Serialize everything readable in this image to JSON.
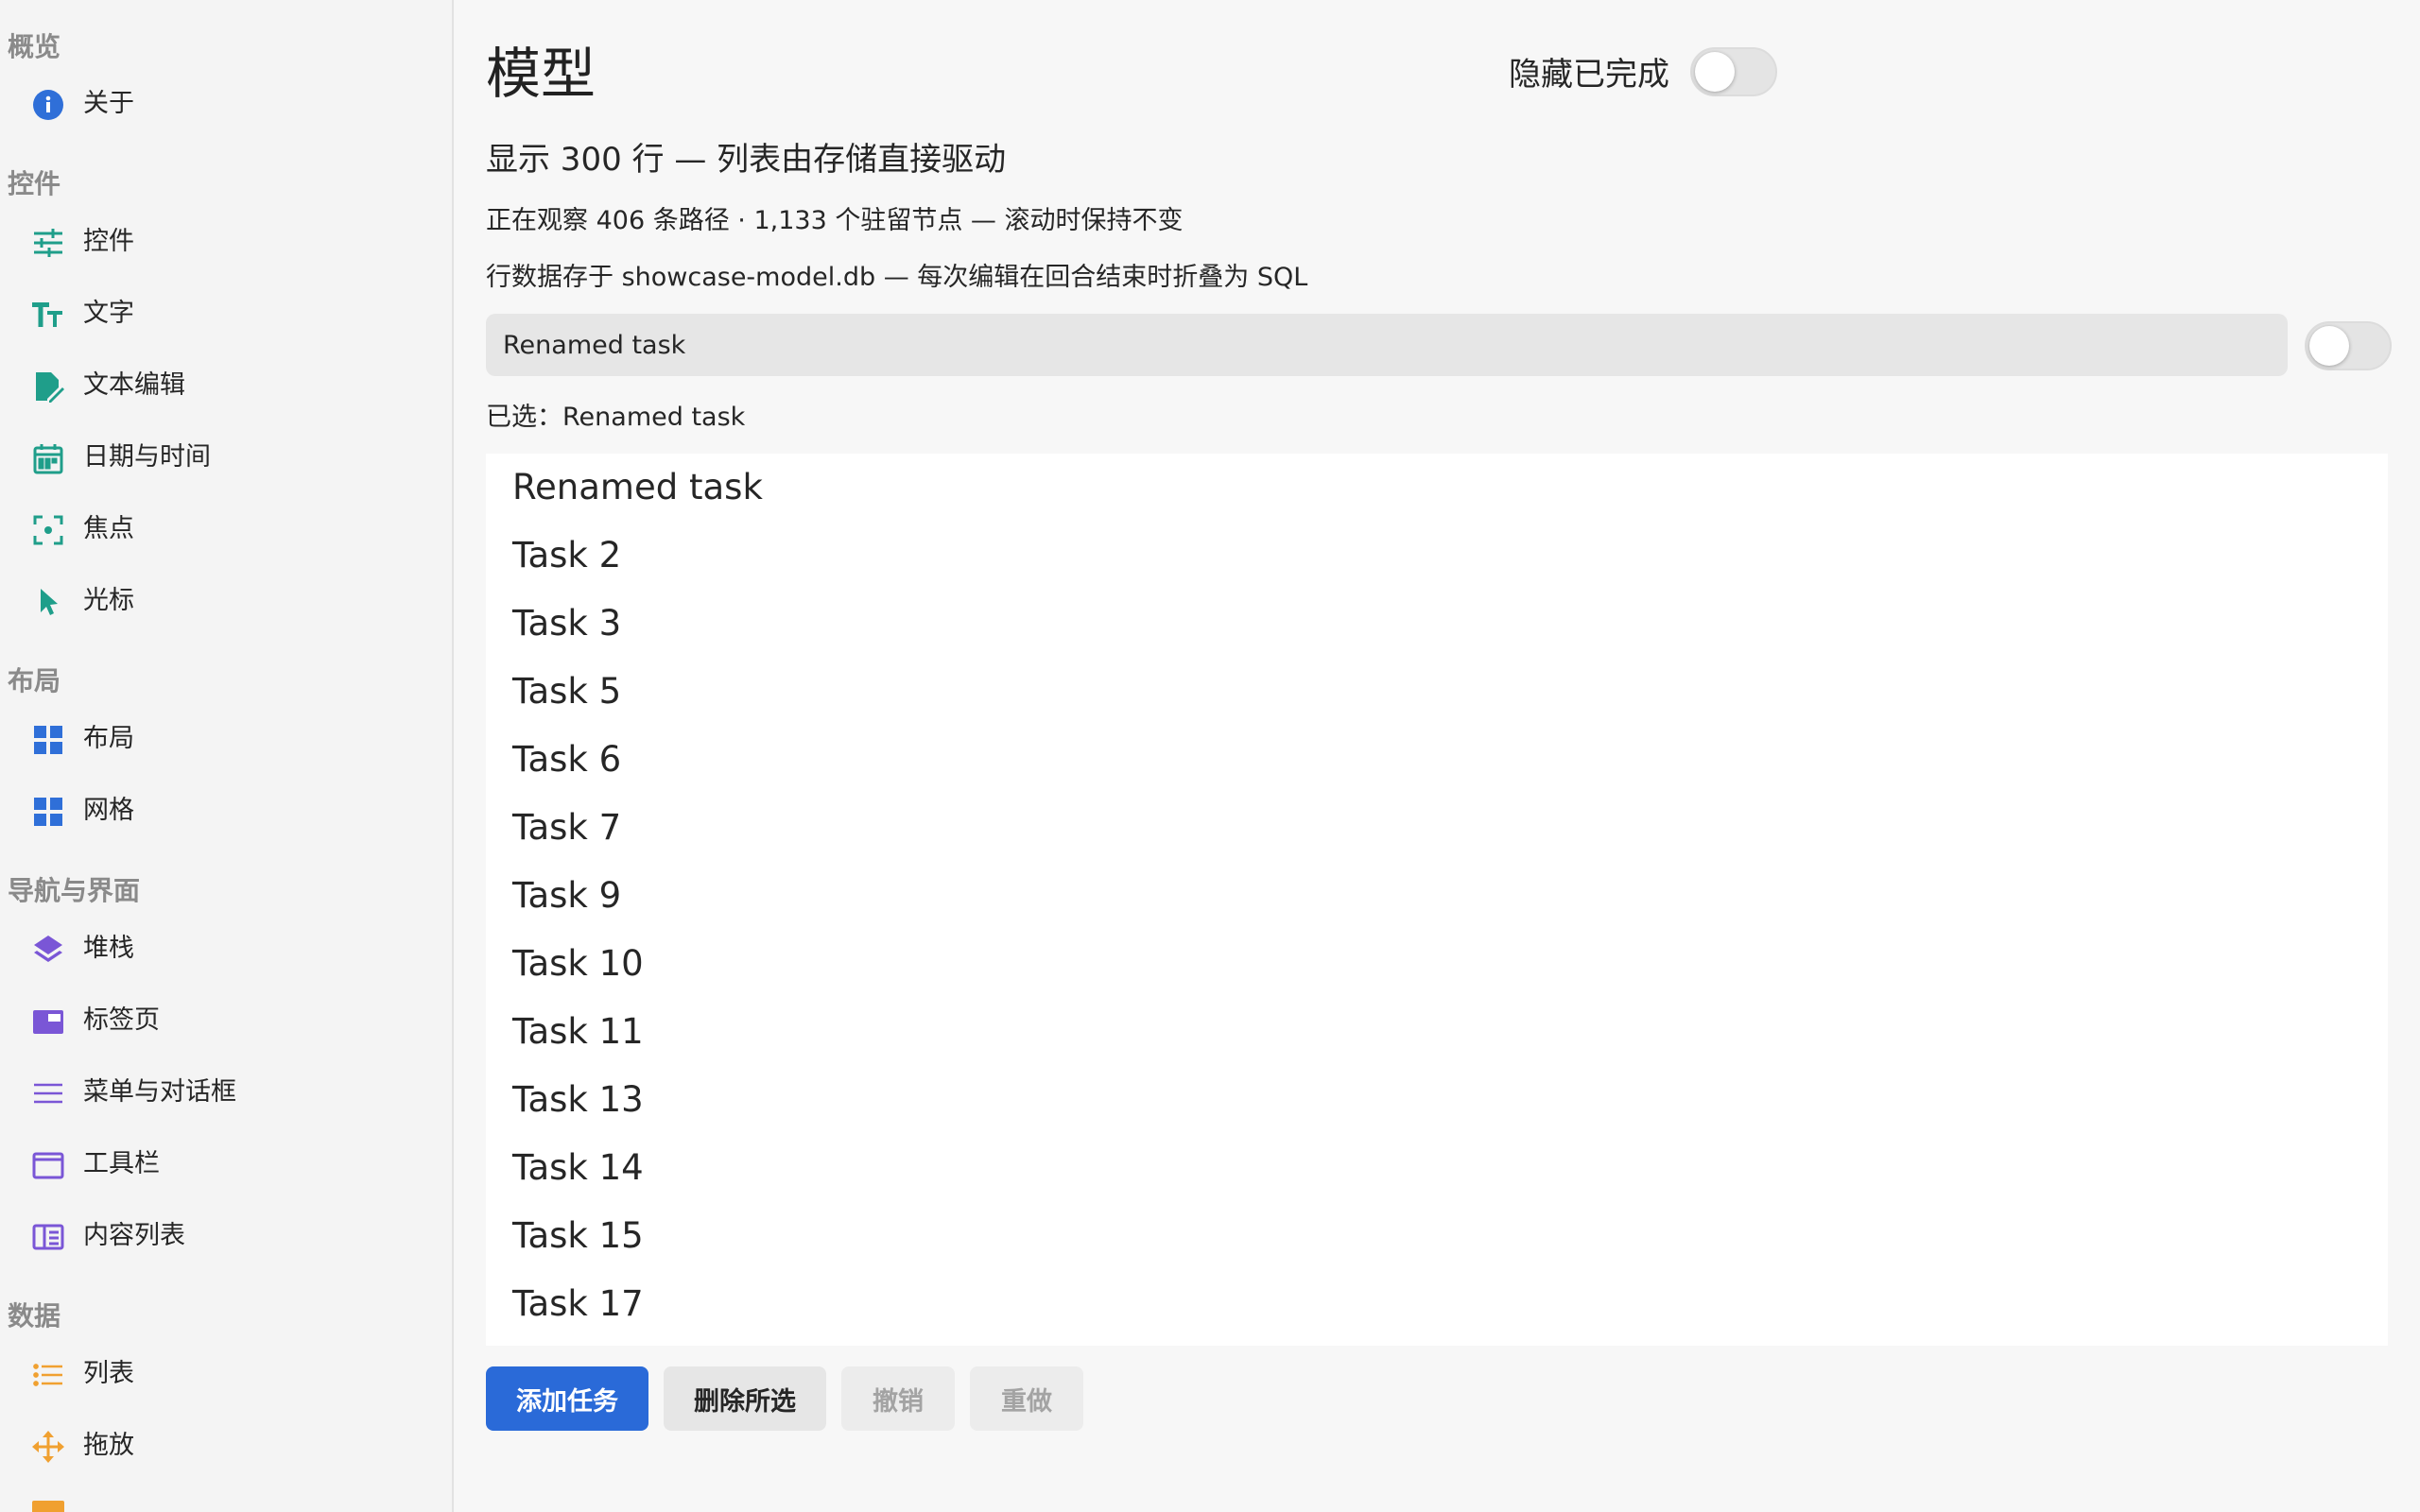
{
  "sidebar": {
    "sections": [
      {
        "title": "概览",
        "items": [
          {
            "label": "关于",
            "icon": "info-icon"
          }
        ]
      },
      {
        "title": "控件",
        "items": [
          {
            "label": "控件",
            "icon": "sliders-icon"
          },
          {
            "label": "文字",
            "icon": "text-size-icon"
          },
          {
            "label": "文本编辑",
            "icon": "edit-document-icon"
          },
          {
            "label": "日期与时间",
            "icon": "calendar-icon"
          },
          {
            "label": "焦点",
            "icon": "focus-icon"
          },
          {
            "label": "光标",
            "icon": "cursor-icon"
          }
        ]
      },
      {
        "title": "布局",
        "items": [
          {
            "label": "布局",
            "icon": "layout-icon"
          },
          {
            "label": "网格",
            "icon": "grid-icon"
          }
        ]
      },
      {
        "title": "导航与界面",
        "items": [
          {
            "label": "堆栈",
            "icon": "layers-icon"
          },
          {
            "label": "标签页",
            "icon": "tabs-icon"
          },
          {
            "label": "菜单与对话框",
            "icon": "menu-icon"
          },
          {
            "label": "工具栏",
            "icon": "toolbar-icon"
          },
          {
            "label": "内容列表",
            "icon": "content-list-icon"
          }
        ]
      },
      {
        "title": "数据",
        "items": [
          {
            "label": "列表",
            "icon": "list-icon"
          },
          {
            "label": "拖放",
            "icon": "move-icon"
          }
        ]
      }
    ]
  },
  "main": {
    "title": "模型",
    "hide_completed_label": "隐藏已完成",
    "hide_completed_on": false,
    "subtitle": "显示 300 行 — 列表由存储直接驱动",
    "info1": "正在观察 406 条路径 · 1,133 个驻留节点 — 滚动时保持不变",
    "info2": "行数据存于 showcase-model.db — 每次编辑在回合结束时折叠为 SQL",
    "input_value": "Renamed task",
    "input_toggle_on": false,
    "selected_text": "已选：Renamed task",
    "tasks": [
      "Renamed task",
      "Task 2",
      "Task 3",
      "Task 5",
      "Task 6",
      "Task 7",
      "Task 9",
      "Task 10",
      "Task 11",
      "Task 13",
      "Task 14",
      "Task 15",
      "Task 17"
    ],
    "buttons": {
      "add": "添加任务",
      "delete": "删除所选",
      "undo": "撤销",
      "redo": "重做"
    }
  },
  "colors": {
    "accent": "#2a6ad8",
    "teal": "#1f9e8a",
    "blue_icon": "#2f6fd8",
    "purple": "#7a56d6",
    "orange": "#f0a030"
  }
}
